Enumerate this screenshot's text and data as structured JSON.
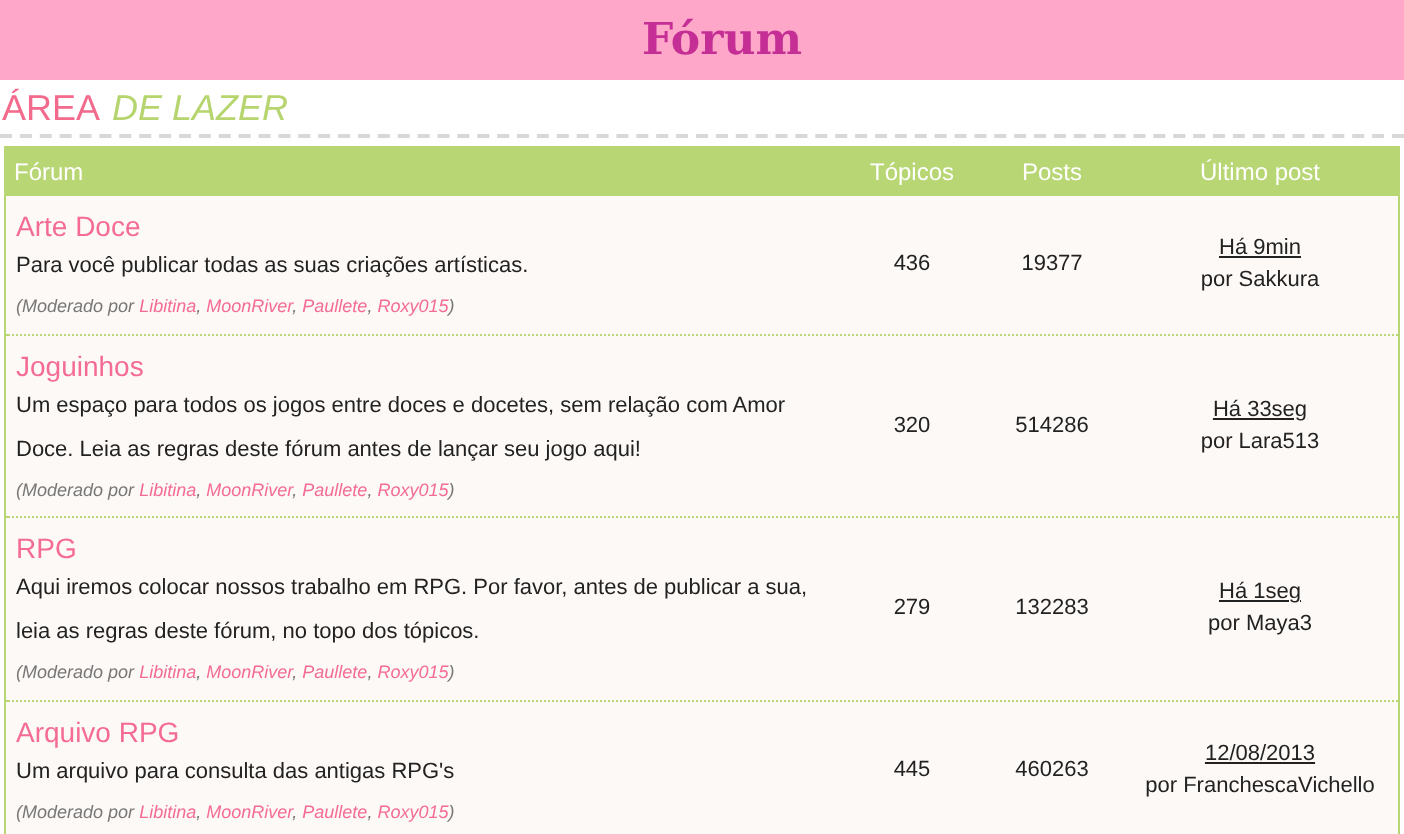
{
  "header": {
    "title": "Fórum"
  },
  "section": {
    "title_first": "ÁREA",
    "title_second": "DE LAZER"
  },
  "table": {
    "columns": [
      "Fórum",
      "Tópicos",
      "Posts",
      "Último post"
    ],
    "rows": [
      {
        "name": "Arte Doce",
        "description": "Para você publicar todas as suas criações artísticas.",
        "moderation": {
          "prefix": "(Moderado por",
          "names": [
            "Libitina",
            "MoonRiver",
            "Paullete",
            "Roxy015"
          ],
          "separator": ",",
          "suffix": ")"
        },
        "topics": "436",
        "posts": "19377",
        "last_time": "Há 9min",
        "last_by": "por Sakkura"
      },
      {
        "name": "Joguinhos",
        "description": "Um espaço para todos os jogos entre doces e docetes, sem relação com Amor Doce. Leia as regras deste fórum antes de lançar seu jogo aqui!",
        "moderation": {
          "prefix": "(Moderado por",
          "names": [
            "Libitina",
            "MoonRiver",
            "Paullete",
            "Roxy015"
          ],
          "separator": ",",
          "suffix": ")"
        },
        "topics": "320",
        "posts": "514286",
        "last_time": "Há 33seg",
        "last_by": "por Lara513"
      },
      {
        "name": "RPG",
        "description": "Aqui iremos colocar nossos trabalho em RPG. Por favor, antes de publicar a sua, leia as regras deste fórum, no topo dos tópicos.",
        "moderation": {
          "prefix": "(Moderado por",
          "names": [
            "Libitina",
            "MoonRiver",
            "Paullete",
            "Roxy015"
          ],
          "separator": ",",
          "suffix": ")"
        },
        "topics": "279",
        "posts": "132283",
        "last_time": "Há 1seg",
        "last_by": "por Maya3"
      },
      {
        "name": "Arquivo RPG",
        "description": "Um arquivo para consulta das antigas RPG's",
        "moderation": {
          "prefix": "(Moderado por",
          "names": [
            "Libitina",
            "MoonRiver",
            "Paullete",
            "Roxy015"
          ],
          "separator": ",",
          "suffix": ")"
        },
        "topics": "445",
        "posts": "460263",
        "last_time": "12/08/2013",
        "last_by": "por FranchescaVichello"
      }
    ]
  }
}
